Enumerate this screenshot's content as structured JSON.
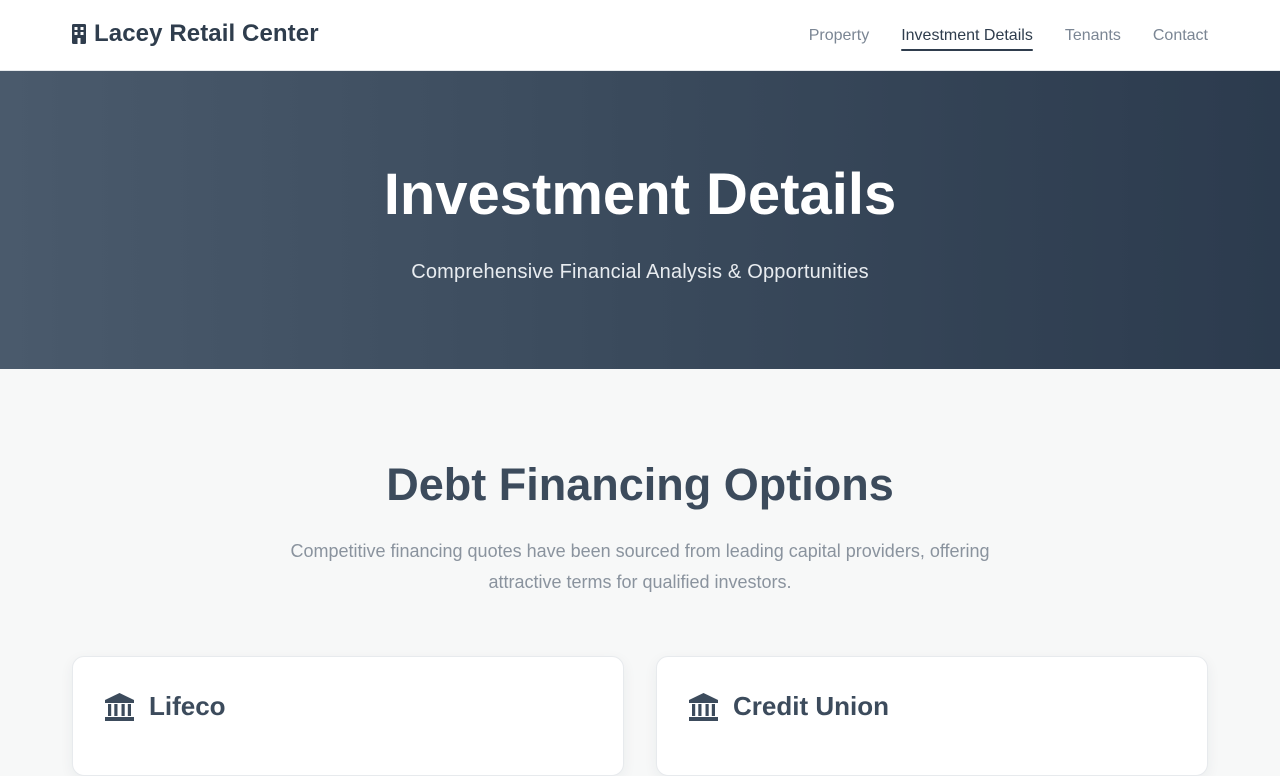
{
  "header": {
    "brand": "Lacey Retail Center",
    "nav": [
      "Property",
      "Investment Details",
      "Tenants",
      "Contact"
    ],
    "active_index": 1
  },
  "hero": {
    "title": "Investment Details",
    "subtitle": "Comprehensive Financial Analysis & Opportunities"
  },
  "section": {
    "title": "Debt Financing Options",
    "description": "Competitive financing quotes have been sourced from leading capital providers, offering attractive terms for qualified investors."
  },
  "cards": [
    {
      "title": "Lifeco",
      "icon": "bank-icon"
    },
    {
      "title": "Credit Union",
      "icon": "bank-icon"
    }
  ],
  "colors": {
    "primary": "#2f3d4d",
    "hero_start": "#4a5a6c",
    "hero_end": "#2c3b4e",
    "muted": "#8a939e"
  }
}
